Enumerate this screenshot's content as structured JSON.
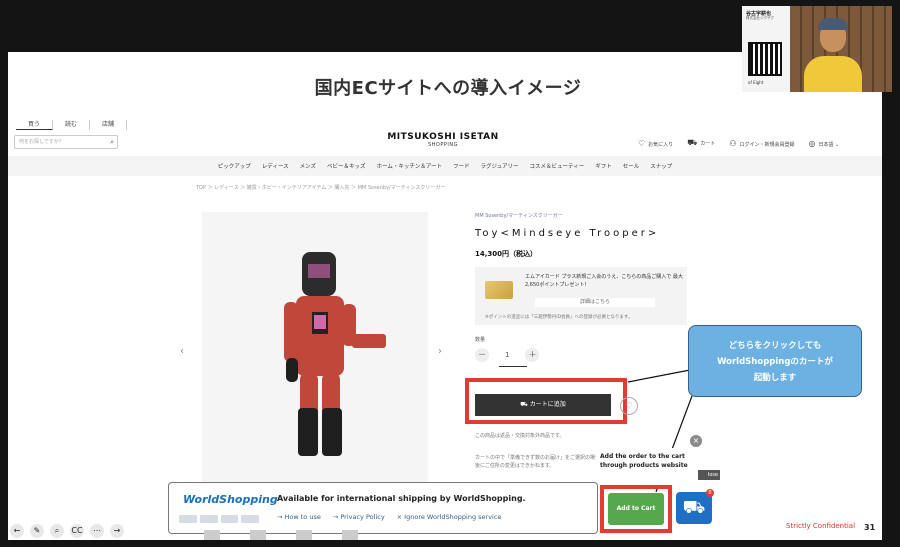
{
  "slide": {
    "title": "国内ECサイトへの導入イメージ",
    "confidential": "Strictly Confidential",
    "page_number": "31"
  },
  "site": {
    "tabs": [
      "買う",
      "読む",
      "店舗"
    ],
    "search_placeholder": "何をお探しですか？",
    "brand_main": "MITSUKOSHI ISETAN",
    "brand_sub": "SHOPPING",
    "favorites": "お気に入り",
    "cart": "カート",
    "login": "ログイン・新規会員登録",
    "language": "日本語",
    "nav": [
      "ピックアップ",
      "レディース",
      "メンズ",
      "ベビー＆キッズ",
      "ホーム・キッチン＆アート",
      "フード",
      "ラグジュアリー",
      "コスメ＆ビューティー",
      "ギフト",
      "セール",
      "スナップ"
    ],
    "breadcrumb": "TOP ＞ レディース ＞ 雑貨・ホビー・インテリアアイテム ＞ 購入先 ＞ MM Sosenby/マーティンスクリーガー"
  },
  "product": {
    "brand": "MM Sosenby/マーティンスクリーガー",
    "name": "Toy<Mindseye Trooper>",
    "price": "14,300円（税込）",
    "promo_text": "エムアイカード プラス新規ご入会のうえ、こちらの商品ご購入で 最大 2,650ポイントプレゼント！",
    "promo_link": "詳細はこちら",
    "promo_note": "※ポイントの進呈には「三越伊勢丹ID会員」への登録が必要となります。",
    "qty_label": "数量",
    "qty_minus": "－",
    "qty_value": "1",
    "qty_plus": "＋",
    "add_to_cart": "カートに追加",
    "fav_icon": "♡",
    "desc1": "この商品は返品・交換対象外商品です。",
    "desc2": "カートの中で「準備できず数のお届け」をご選択の場合、発送後にご住所の変更はできかねます。"
  },
  "callout": {
    "line1": "どちらをクリックしても",
    "line2": "WorldShoppingのカートが",
    "line3": "起動します"
  },
  "popup": {
    "line1": "Add the order to the cart",
    "line2": "through products website",
    "close_symbol": "×",
    "close_tab": "lose"
  },
  "worldshopping": {
    "logo": "WorldShopping",
    "main": "Available for international shipping by WorldShopping.",
    "link_howto": "→ How to use",
    "link_privacy": "→ Privacy Policy",
    "link_ignore": "× Ignore WorldShopping service",
    "add_to_cart": "Add to Cart",
    "badge": "0"
  },
  "video": {
    "name": "谷古宇耕也",
    "sub": "株式会社ジグザグ",
    "qr_caption": "of Eight"
  },
  "toolbar": [
    "←",
    "✎",
    "⌕",
    "CC",
    "⋯",
    "→"
  ],
  "colors": {
    "accent_red": "#e23c32",
    "callout_blue": "#6cb1e1",
    "ws_blue": "#1f6fc4",
    "add_cart_green": "#56a84d"
  }
}
